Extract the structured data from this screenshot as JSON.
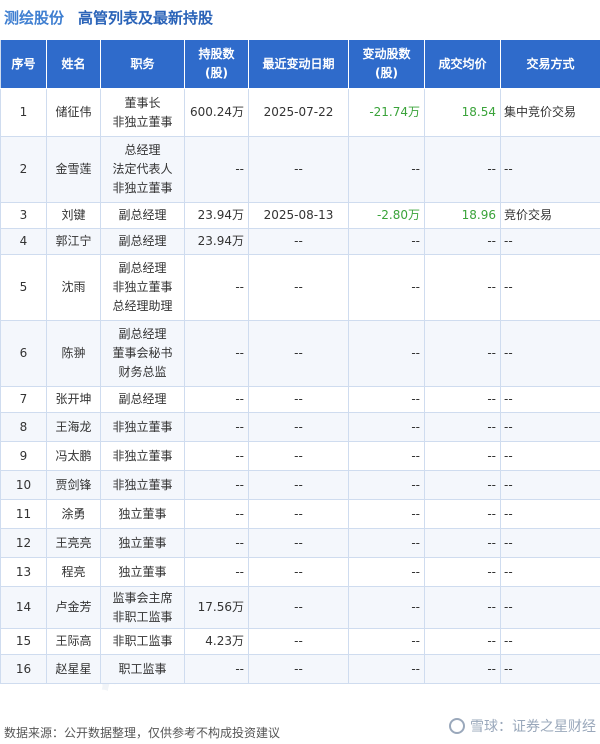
{
  "header": {
    "stock_name": "测绘股份",
    "subtitle": "高管列表及最新持股"
  },
  "table": {
    "columns": [
      "序号",
      "姓名",
      "职务",
      "持股数\n(股)",
      "最近变动日期",
      "变动股数\n(股)",
      "成交均价",
      "交易方式"
    ],
    "rows": [
      {
        "no": "1",
        "name": "储征伟",
        "roles": [
          "董事长",
          "非独立董事"
        ],
        "shares": "600.24万",
        "date": "2025-07-22",
        "change": "-21.74万",
        "price": "18.54",
        "method": "集中竞价交易"
      },
      {
        "no": "2",
        "name": "金雪莲",
        "roles": [
          "总经理",
          "法定代表人",
          "非独立董事"
        ],
        "shares": "--",
        "date": "--",
        "change": "--",
        "price": "--",
        "method": "--"
      },
      {
        "no": "3",
        "name": "刘键",
        "roles": [
          "副总经理"
        ],
        "shares": "23.94万",
        "date": "2025-08-13",
        "change": "-2.80万",
        "price": "18.96",
        "method": "竞价交易"
      },
      {
        "no": "4",
        "name": "郭江宁",
        "roles": [
          "副总经理"
        ],
        "shares": "23.94万",
        "date": "--",
        "change": "--",
        "price": "--",
        "method": "--"
      },
      {
        "no": "5",
        "name": "沈雨",
        "roles": [
          "副总经理",
          "非独立董事",
          "总经理助理"
        ],
        "shares": "--",
        "date": "--",
        "change": "--",
        "price": "--",
        "method": "--"
      },
      {
        "no": "6",
        "name": "陈翀",
        "roles": [
          "副总经理",
          "董事会秘书",
          "财务总监"
        ],
        "shares": "--",
        "date": "--",
        "change": "--",
        "price": "--",
        "method": "--"
      },
      {
        "no": "7",
        "name": "张开坤",
        "roles": [
          "副总经理"
        ],
        "shares": "--",
        "date": "--",
        "change": "--",
        "price": "--",
        "method": "--"
      },
      {
        "no": "8",
        "name": "王海龙",
        "roles": [
          "非独立董事"
        ],
        "shares": "--",
        "date": "--",
        "change": "--",
        "price": "--",
        "method": "--"
      },
      {
        "no": "9",
        "name": "冯太鹏",
        "roles": [
          "非独立董事"
        ],
        "shares": "--",
        "date": "--",
        "change": "--",
        "price": "--",
        "method": "--"
      },
      {
        "no": "10",
        "name": "贾剑锋",
        "roles": [
          "非独立董事"
        ],
        "shares": "--",
        "date": "--",
        "change": "--",
        "price": "--",
        "method": "--"
      },
      {
        "no": "11",
        "name": "涂勇",
        "roles": [
          "独立董事"
        ],
        "shares": "--",
        "date": "--",
        "change": "--",
        "price": "--",
        "method": "--"
      },
      {
        "no": "12",
        "name": "王亮亮",
        "roles": [
          "独立董事"
        ],
        "shares": "--",
        "date": "--",
        "change": "--",
        "price": "--",
        "method": "--"
      },
      {
        "no": "13",
        "name": "程亮",
        "roles": [
          "独立董事"
        ],
        "shares": "--",
        "date": "--",
        "change": "--",
        "price": "--",
        "method": "--"
      },
      {
        "no": "14",
        "name": "卢金芳",
        "roles": [
          "监事会主席",
          "非职工监事"
        ],
        "shares": "17.56万",
        "date": "--",
        "change": "--",
        "price": "--",
        "method": "--"
      },
      {
        "no": "15",
        "name": "王际高",
        "roles": [
          "非职工监事"
        ],
        "shares": "4.23万",
        "date": "--",
        "change": "--",
        "price": "--",
        "method": "--"
      },
      {
        "no": "16",
        "name": "赵星星",
        "roles": [
          "职工监事"
        ],
        "shares": "--",
        "date": "--",
        "change": "--",
        "price": "--",
        "method": "--"
      }
    ]
  },
  "footer": {
    "source": "数据来源：公开数据整理，仅供参考不构成投资建议",
    "brand": "雪球：证券之星财经"
  },
  "colors": {
    "header_bg": "#2f6bcb",
    "title_blue": "#2a63b8",
    "change_green": "#3aa33a"
  }
}
